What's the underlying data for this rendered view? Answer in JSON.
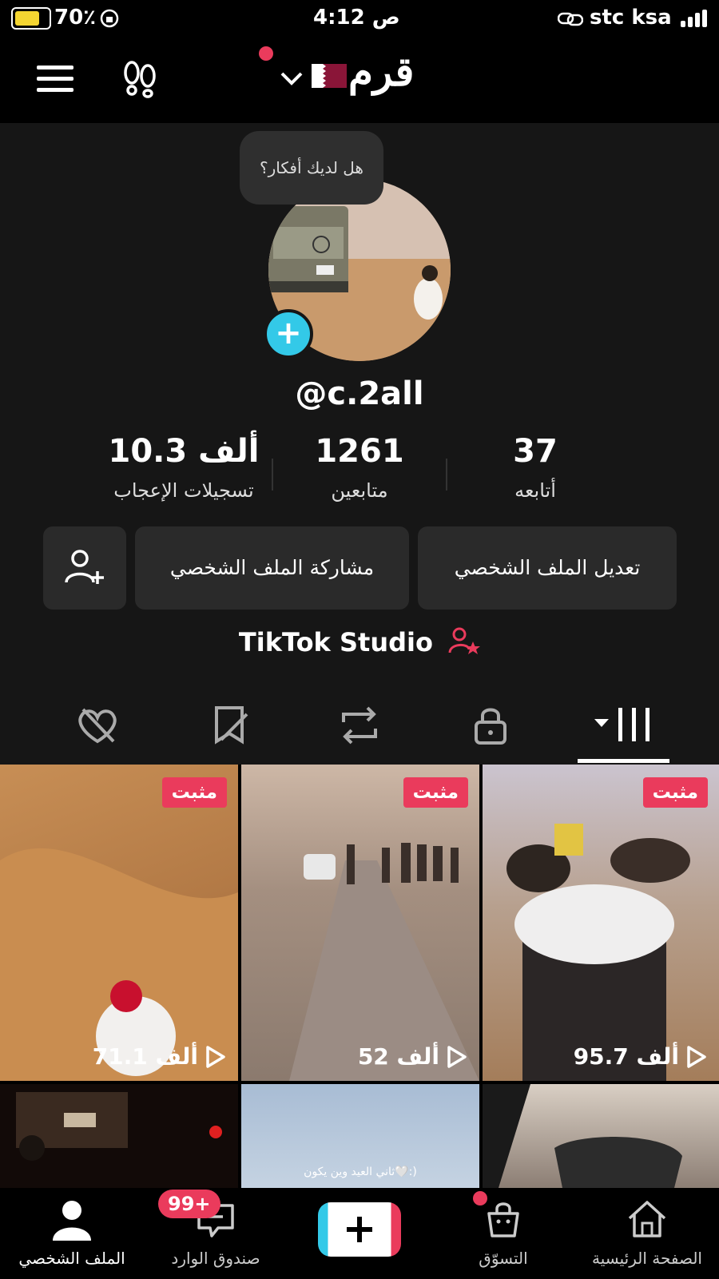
{
  "status_bar": {
    "battery": "70٪",
    "time": "4:12 ص",
    "carrier": "stc ksa"
  },
  "top_nav": {
    "title": "قرم"
  },
  "profile": {
    "bubble_text": "هل لديك أفكار؟",
    "username": "@c.2all",
    "stats": [
      {
        "value": "10.3 ألف",
        "label": "تسجيلات الإعجاب"
      },
      {
        "value": "1261",
        "label": "متابعين"
      },
      {
        "value": "37",
        "label": "أتابعه"
      }
    ],
    "buttons": {
      "share": "مشاركة الملف الشخصي",
      "edit": "تعديل الملف الشخصي"
    },
    "studio": "TikTok Studio"
  },
  "videos": [
    {
      "pinned": "مثبت",
      "views": "71.1 ألف"
    },
    {
      "pinned": "مثبت",
      "views": "52 ألف"
    },
    {
      "pinned": "مثبت",
      "views": "95.7 ألف"
    },
    {
      "caption": "ثاني العيد وين يكون🤍:)"
    }
  ],
  "bottom_nav": {
    "profile": "الملف الشخصي",
    "inbox": "صندوق الوارد",
    "inbox_badge": "99+",
    "shop": "التسوّق",
    "home": "الصفحة الرئيسية"
  },
  "colors": {
    "pin_red": "#ea3b5c",
    "accent_cyan": "#33c9e8",
    "battery_yellow": "#f4d531"
  }
}
